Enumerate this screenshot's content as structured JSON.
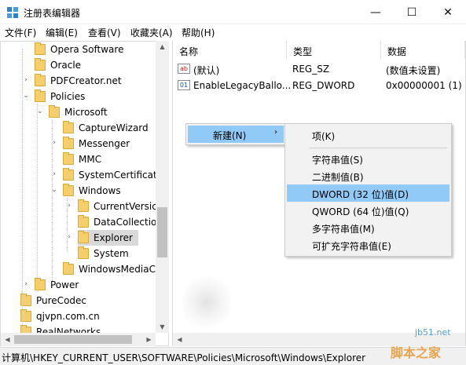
{
  "window": {
    "title": "注册表编辑器",
    "min_icon": "minimize-icon",
    "max_icon": "maximize-icon",
    "close_icon": "close-icon"
  },
  "menu": [
    "文件(F)",
    "编辑(E)",
    "查看(V)",
    "收藏夹(A)",
    "帮助(H)"
  ],
  "tree": [
    {
      "label": "Opera Software",
      "expander": ""
    },
    {
      "label": "Oracle",
      "expander": ""
    },
    {
      "label": "PDFCreator.net",
      "expander": ">"
    },
    {
      "label": "Policies",
      "expander": "v"
    },
    {
      "label": "Microsoft",
      "expander": "v"
    },
    {
      "label": "CaptureWizard",
      "expander": ""
    },
    {
      "label": "Messenger",
      "expander": ">"
    },
    {
      "label": "MMC",
      "expander": ""
    },
    {
      "label": "SystemCertificate",
      "expander": ">"
    },
    {
      "label": "Windows",
      "expander": "v"
    },
    {
      "label": "CurrentVersic",
      "expander": ">"
    },
    {
      "label": "DataCollectio",
      "expander": ""
    },
    {
      "label": "Explorer",
      "expander": ">",
      "selected": true
    },
    {
      "label": "System",
      "expander": ""
    },
    {
      "label": "WindowsMediaC",
      "expander": ""
    },
    {
      "label": "Power",
      "expander": ">"
    },
    {
      "label": "PureCodec",
      "expander": ""
    },
    {
      "label": "qjvpn.com.cn",
      "expander": ""
    },
    {
      "label": "RealNetworks",
      "expander": ""
    }
  ],
  "columns": {
    "name": "名称",
    "type": "类型",
    "data": "数据"
  },
  "values": [
    {
      "icon": "ab",
      "name": "(默认)",
      "type": "REG_SZ",
      "data": "(数值未设置)"
    },
    {
      "icon": "01",
      "name": "EnableLegacyBallo...",
      "type": "REG_DWORD",
      "data": "0x00000001 (1)"
    }
  ],
  "context_menu": {
    "new_label": "新建(N)",
    "arrow": "›"
  },
  "submenu": {
    "key": "项(K)",
    "items": [
      "字符串值(S)",
      "二进制值(B)",
      "DWORD (32 位)值(D)",
      "QWORD (64 位)值(Q)",
      "多字符串值(M)",
      "可扩充字符串值(E)"
    ],
    "highlighted_index": 2
  },
  "status": "计算机\\HKEY_CURRENT_USER\\SOFTWARE\\Policies\\Microsoft\\Windows\\Explorer",
  "watermark": {
    "site": "jb51.net",
    "name": "脚本之家"
  },
  "colors": {
    "highlight": "#91c9f7",
    "folder": "#f5cf6b",
    "selected_row": "#d9d9d9"
  }
}
